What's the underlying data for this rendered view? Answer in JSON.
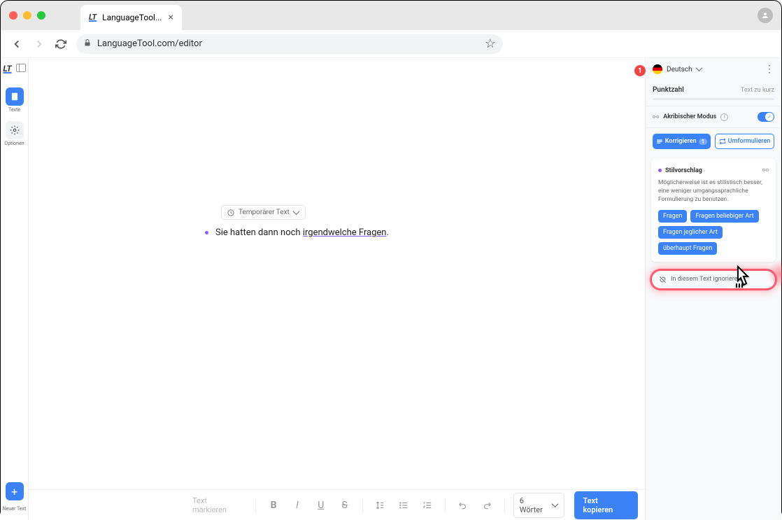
{
  "browser": {
    "tab_title": "LanguageTool...",
    "url": "LanguageTool.com/editor"
  },
  "left_sidebar": {
    "texts_label": "Texte",
    "options_label": "Optionen",
    "new_text_label": "Neuer Text"
  },
  "editor": {
    "temp_text_label": "Temporärer Text",
    "text_before": "Sie hatten dann noch ",
    "text_highlight": "irgendwelche Fragen",
    "text_after": "."
  },
  "toolbar": {
    "placeholder": "Text markieren",
    "word_count": "6 Wörter",
    "copy_label": "Text kopieren"
  },
  "right_panel": {
    "error_count": "1",
    "language": "Deutsch",
    "score_label": "Punktzahl",
    "score_hint": "Text zu kurz",
    "mode_label": "Akribischer Modus",
    "correct_label": "Korrigieren",
    "correct_count": "1",
    "rephrase_label": "Umformulieren",
    "suggestion": {
      "title": "Stilvorschlag",
      "description": "Möglicherweise ist es stilistisch besser, eine weniger umgangssprachliche Formulierung zu benutzen.",
      "chips": [
        "Fragen",
        "Fragen beliebiger Art",
        "Fragen jeglicher Art",
        "überhaupt Fragen"
      ]
    },
    "ignore_label": "In diesem Text ignorieren"
  }
}
